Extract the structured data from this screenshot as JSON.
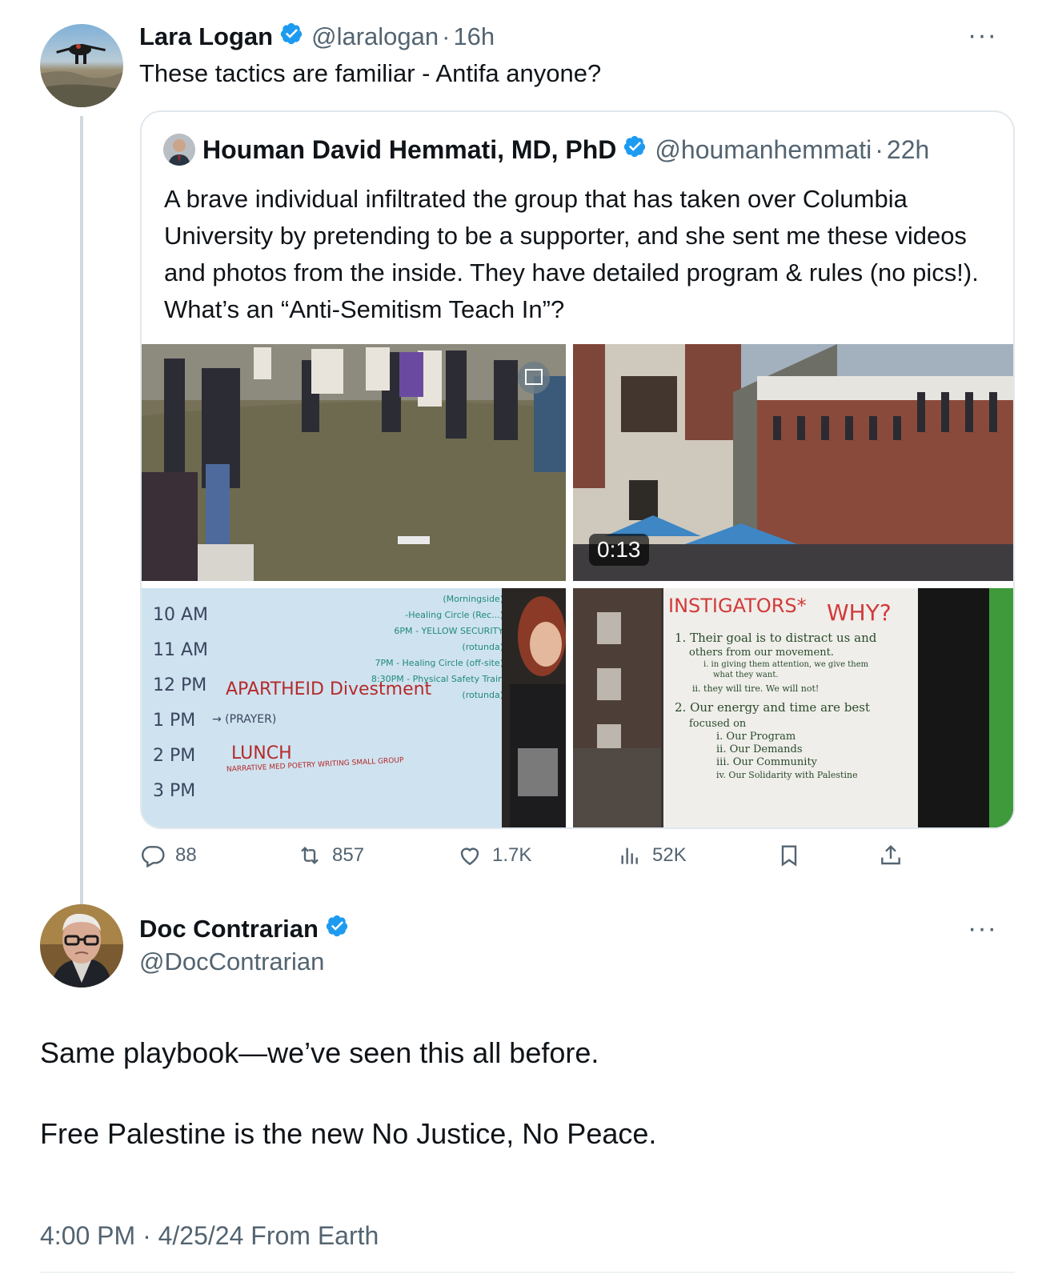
{
  "tweet": {
    "author_name": "Lara Logan",
    "author_handle": "@laralogan",
    "time_sep": "·",
    "time": "16h",
    "text": "These tactics are familiar - Antifa anyone?",
    "more_label": "···"
  },
  "quote": {
    "author_name": "Houman David Hemmati, MD, PhD",
    "author_handle": "@houmanhemmati",
    "time_sep": "·",
    "time": "22h",
    "text": "A brave individual infiltrated the group that has taken over Columbia University by pretending to be a supporter, and she sent me these videos and photos from the inside. They have detailed program & rules (no pics!). What’s an “Anti-Semitism Teach In”?",
    "video_duration": "0:13",
    "schedule": {
      "times": [
        "10 AM",
        "11 AM",
        "12 PM",
        "1 PM",
        "2 PM",
        "3 PM"
      ],
      "items": [
        "APARTHEID Divestment",
        "→ (PRAYER)",
        "LUNCH",
        "NARRATIVE MED POETRY WRITING SMALL GROUP"
      ],
      "evening": [
        "(Morningside)",
        "-Healing Circle (Rec...)",
        "6PM - YELLOW SECURITY (rotunda)",
        "7PM - Healing Circle (off-site)",
        "8:30PM - Physical Safety Train",
        "(rotunda)"
      ]
    },
    "sign": {
      "heading": "INSTIGATORS*",
      "why": "WHY?",
      "lines": [
        "1. Their goal is to distract us and",
        "others from our movement.",
        "i. in giving them attention, we give them",
        "what they want.",
        "ii. they will tire. We will not!",
        "2. Our energy and time are best",
        "focused on",
        "i. Our Program",
        "ii. Our Demands",
        "iii. Our Community",
        "iv. Our Solidarity with Palestine"
      ]
    }
  },
  "actions": {
    "replies": "88",
    "reposts": "857",
    "likes": "1.7K",
    "views": "52K"
  },
  "reply": {
    "author_name": "Doc Contrarian",
    "author_handle": "@DocContrarian",
    "text_1": "Same playbook—we’ve seen this all before.",
    "text_2": "Free Palestine is the new No Justice, No Peace.",
    "timestamp": "4:00 PM · 4/25/24 From Earth",
    "more_label": "···"
  },
  "colors": {
    "verified": "#1d9bf0",
    "secondary_text": "#536471",
    "border": "#e1e8ed"
  }
}
